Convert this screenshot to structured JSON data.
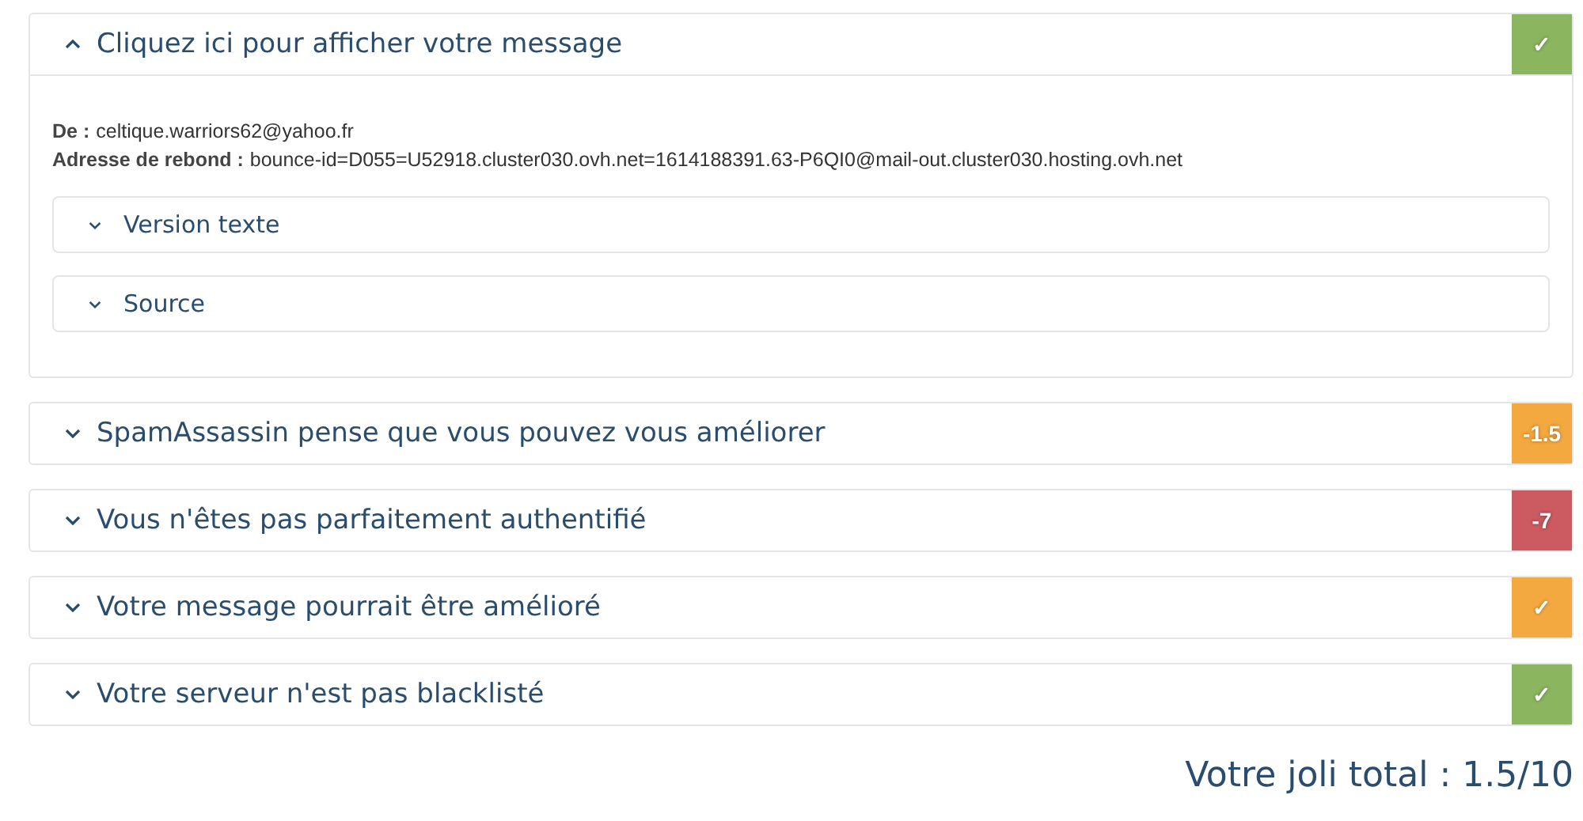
{
  "panels": [
    {
      "title": "Cliquez ici pour afficher votre message",
      "expanded": true,
      "badge": "✓",
      "color": "#8cb560",
      "details": [
        {
          "label": "De :",
          "value": "celtique.warriors62@yahoo.fr"
        },
        {
          "label": "Adresse de rebond :",
          "value": "bounce-id=D055=U52918.cluster030.ovh.net=1614188391.63-P6QI0@mail-out.cluster030.hosting.ovh.net"
        }
      ],
      "subpanels": [
        {
          "title": "Version texte",
          "expanded": false
        },
        {
          "title": "Source",
          "expanded": false
        }
      ]
    },
    {
      "title": "SpamAssassin pense que vous pouvez vous améliorer",
      "expanded": false,
      "badge": "-1.5",
      "color": "#f4a940"
    },
    {
      "title": "Vous n'êtes pas parfaitement authentifié",
      "expanded": false,
      "badge": "-7",
      "color": "#cc5a61"
    },
    {
      "title": "Votre message pourrait être amélioré",
      "expanded": false,
      "badge": "✓",
      "color": "#f4a940"
    },
    {
      "title": "Votre serveur n'est pas blacklisté",
      "expanded": false,
      "badge": "✓",
      "color": "#8cb560"
    }
  ],
  "total": "Votre joli total : 1.5/10"
}
